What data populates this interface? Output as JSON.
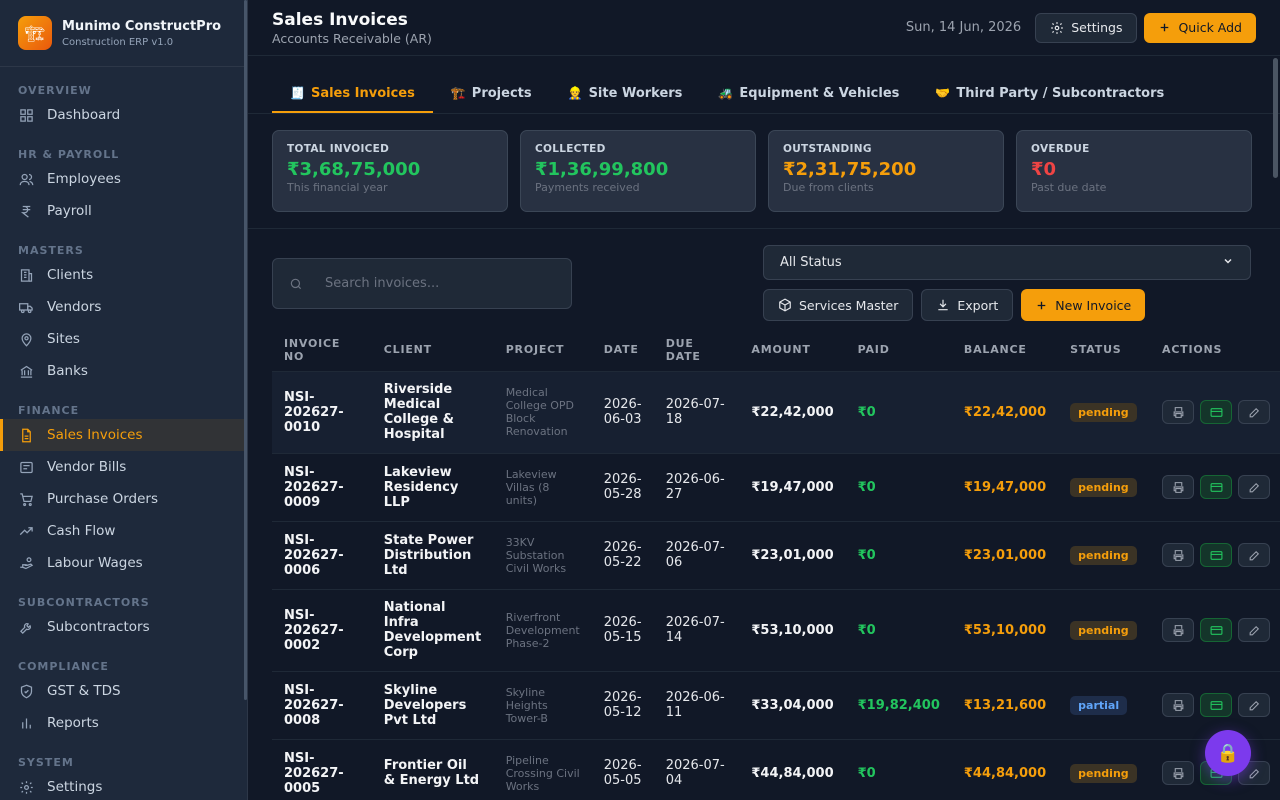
{
  "brand": {
    "name": "Munimo ConstructPro",
    "version": "Construction ERP v1.0"
  },
  "sidebar": {
    "sections": [
      {
        "title": "OVERVIEW",
        "items": [
          {
            "label": "Dashboard",
            "icon": "dashboard-icon"
          }
        ]
      },
      {
        "title": "HR & PAYROLL",
        "items": [
          {
            "label": "Employees",
            "icon": "users-icon"
          },
          {
            "label": "Payroll",
            "icon": "rupee-icon"
          }
        ]
      },
      {
        "title": "MASTERS",
        "items": [
          {
            "label": "Clients",
            "icon": "building-icon"
          },
          {
            "label": "Vendors",
            "icon": "truck-icon"
          },
          {
            "label": "Sites",
            "icon": "map-pin-icon"
          },
          {
            "label": "Banks",
            "icon": "bank-icon"
          }
        ]
      },
      {
        "title": "FINANCE",
        "items": [
          {
            "label": "Sales Invoices",
            "icon": "file-icon",
            "active": true
          },
          {
            "label": "Vendor Bills",
            "icon": "receipt-icon"
          },
          {
            "label": "Purchase Orders",
            "icon": "cart-icon"
          },
          {
            "label": "Cash Flow",
            "icon": "trend-icon"
          },
          {
            "label": "Labour Wages",
            "icon": "hand-coins-icon"
          }
        ]
      },
      {
        "title": "SUBCONTRACTORS",
        "items": [
          {
            "label": "Subcontractors",
            "icon": "wrench-icon"
          }
        ]
      },
      {
        "title": "COMPLIANCE",
        "items": [
          {
            "label": "GST & TDS",
            "icon": "shield-icon"
          },
          {
            "label": "Reports",
            "icon": "bar-chart-icon"
          }
        ]
      },
      {
        "title": "SYSTEM",
        "items": [
          {
            "label": "Settings",
            "icon": "gear-icon"
          }
        ]
      }
    ]
  },
  "header": {
    "title": "Sales Invoices",
    "subtitle": "Accounts Receivable (AR)",
    "date": "Sun, 14 Jun, 2026",
    "settings_label": "Settings",
    "quick_add_label": "Quick Add"
  },
  "tabs": [
    {
      "emoji": "🧾",
      "label": "Sales Invoices",
      "active": true
    },
    {
      "emoji": "🏗️",
      "label": "Projects"
    },
    {
      "emoji": "👷",
      "label": "Site Workers"
    },
    {
      "emoji": "🚜",
      "label": "Equipment & Vehicles"
    },
    {
      "emoji": "🤝",
      "label": "Third Party / Subcontractors"
    }
  ],
  "stats": [
    {
      "label": "TOTAL INVOICED",
      "value": "₹3,68,75,000",
      "sub": "This financial year",
      "color": "#22c55e"
    },
    {
      "label": "COLLECTED",
      "value": "₹1,36,99,800",
      "sub": "Payments received",
      "color": "#22c55e"
    },
    {
      "label": "OUTSTANDING",
      "value": "₹2,31,75,200",
      "sub": "Due from clients",
      "color": "#f59e0b"
    },
    {
      "label": "OVERDUE",
      "value": "₹0",
      "sub": "Past due date",
      "color": "#ef4444"
    }
  ],
  "toolbar": {
    "search_placeholder": "Search invoices...",
    "status_selected": "All Status",
    "services_label": "Services Master",
    "export_label": "Export",
    "new_invoice_label": "New Invoice"
  },
  "table": {
    "columns": [
      "INVOICE NO",
      "CLIENT",
      "PROJECT",
      "DATE",
      "DUE DATE",
      "AMOUNT",
      "PAID",
      "BALANCE",
      "STATUS",
      "ACTIONS"
    ],
    "rows": [
      {
        "invoice_no": "NSI-202627-0010",
        "client": "Riverside Medical College & Hospital",
        "project": "Medical College OPD Block Renovation",
        "date": "2026-06-03",
        "due": "2026-07-18",
        "amount": "₹22,42,000",
        "paid": "₹0",
        "balance": "₹22,42,000",
        "status": "pending"
      },
      {
        "invoice_no": "NSI-202627-0009",
        "client": "Lakeview Residency LLP",
        "project": "Lakeview Villas (8 units)",
        "date": "2026-05-28",
        "due": "2026-06-27",
        "amount": "₹19,47,000",
        "paid": "₹0",
        "balance": "₹19,47,000",
        "status": "pending"
      },
      {
        "invoice_no": "NSI-202627-0006",
        "client": "State Power Distribution Ltd",
        "project": "33KV Substation Civil Works",
        "date": "2026-05-22",
        "due": "2026-07-06",
        "amount": "₹23,01,000",
        "paid": "₹0",
        "balance": "₹23,01,000",
        "status": "pending"
      },
      {
        "invoice_no": "NSI-202627-0002",
        "client": "National Infra Development Corp",
        "project": "Riverfront Development Phase-2",
        "date": "2026-05-15",
        "due": "2026-07-14",
        "amount": "₹53,10,000",
        "paid": "₹0",
        "balance": "₹53,10,000",
        "status": "pending"
      },
      {
        "invoice_no": "NSI-202627-0008",
        "client": "Skyline Developers Pvt Ltd",
        "project": "Skyline Heights Tower-B",
        "date": "2026-05-12",
        "due": "2026-06-11",
        "amount": "₹33,04,000",
        "paid": "₹19,82,400",
        "balance": "₹13,21,600",
        "status": "partial"
      },
      {
        "invoice_no": "NSI-202627-0005",
        "client": "Frontier Oil & Energy Ltd",
        "project": "Pipeline Crossing Civil Works",
        "date": "2026-05-05",
        "due": "2026-07-04",
        "amount": "₹44,84,000",
        "paid": "₹0",
        "balance": "₹44,84,000",
        "status": "pending"
      }
    ]
  },
  "colors": {
    "accent": "#f59e0b",
    "green": "#22c55e",
    "red": "#ef4444",
    "purple": "#7c3aed"
  }
}
